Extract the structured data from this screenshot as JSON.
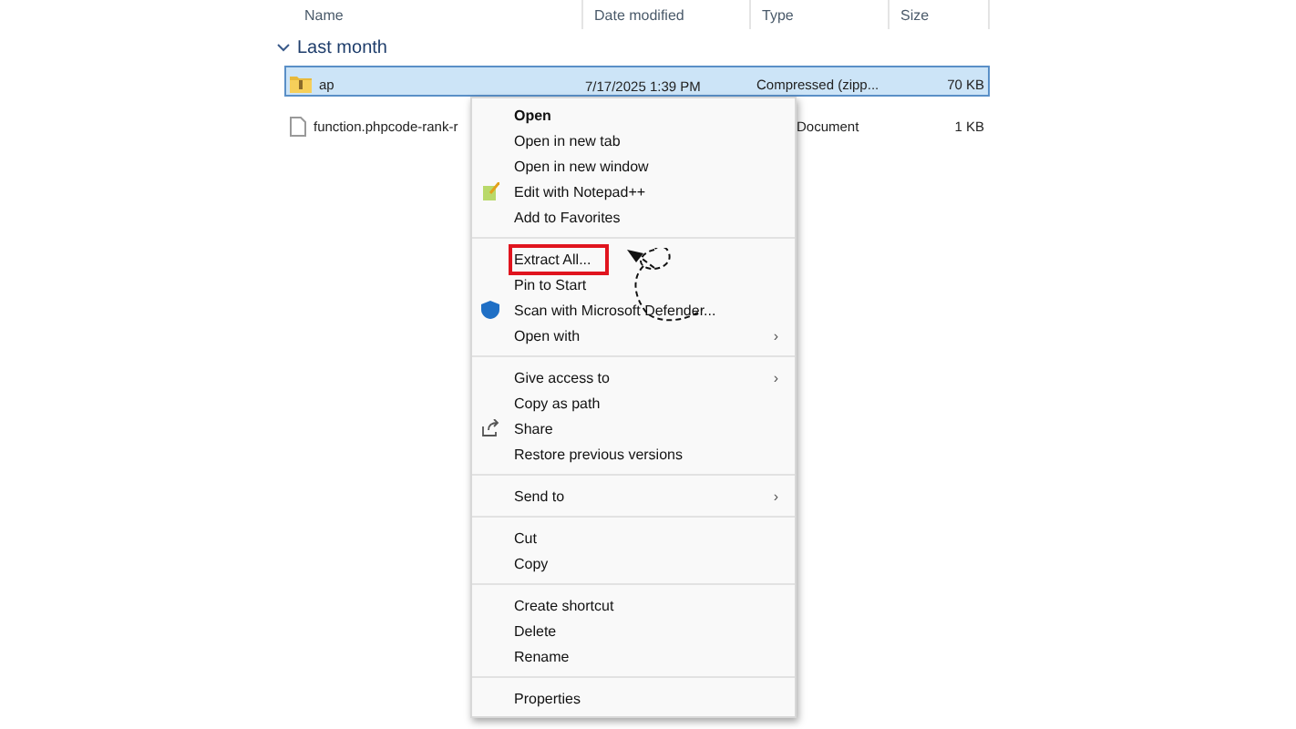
{
  "columns": [
    "Name",
    "Date modified",
    "Type",
    "Size"
  ],
  "group": {
    "label": "Last month",
    "expanded": true
  },
  "files": [
    {
      "name": "ap",
      "date": "7/17/2025 1:39 PM",
      "type": "Compressed (zipp...",
      "size": "70 KB",
      "selected": true
    },
    {
      "name": "function.phpcode-rank-r",
      "type": "Document",
      "size": "1 KB",
      "selected": false
    }
  ],
  "menu": [
    {
      "kind": "item",
      "label": "Open",
      "bold": true
    },
    {
      "kind": "item",
      "label": "Open in new tab"
    },
    {
      "kind": "item",
      "label": "Open in new window"
    },
    {
      "kind": "item",
      "label": "Edit with Notepad++"
    },
    {
      "kind": "item",
      "label": "Add to Favorites"
    },
    {
      "kind": "separator"
    },
    {
      "kind": "item",
      "label": "Extract All...",
      "highlighted": true
    },
    {
      "kind": "item",
      "label": "Pin to Start"
    },
    {
      "kind": "item",
      "label": "Scan with Microsoft Defender..."
    },
    {
      "kind": "item",
      "label": "Open with",
      "submenu": "›"
    },
    {
      "kind": "separator"
    },
    {
      "kind": "item",
      "label": "Give access to",
      "submenu": "›"
    },
    {
      "kind": "item",
      "label": "Copy as path"
    },
    {
      "kind": "item",
      "label": "Share"
    },
    {
      "kind": "item",
      "label": "Restore previous versions"
    },
    {
      "kind": "separator"
    },
    {
      "kind": "item",
      "label": "Send to",
      "submenu": "›"
    },
    {
      "kind": "separator"
    },
    {
      "kind": "item",
      "label": "Cut"
    },
    {
      "kind": "item",
      "label": "Copy"
    },
    {
      "kind": "separator"
    },
    {
      "kind": "item",
      "label": "Create shortcut"
    },
    {
      "kind": "item",
      "label": "Delete"
    },
    {
      "kind": "item",
      "label": "Rename"
    },
    {
      "kind": "separator"
    },
    {
      "kind": "item",
      "label": "Properties"
    }
  ]
}
